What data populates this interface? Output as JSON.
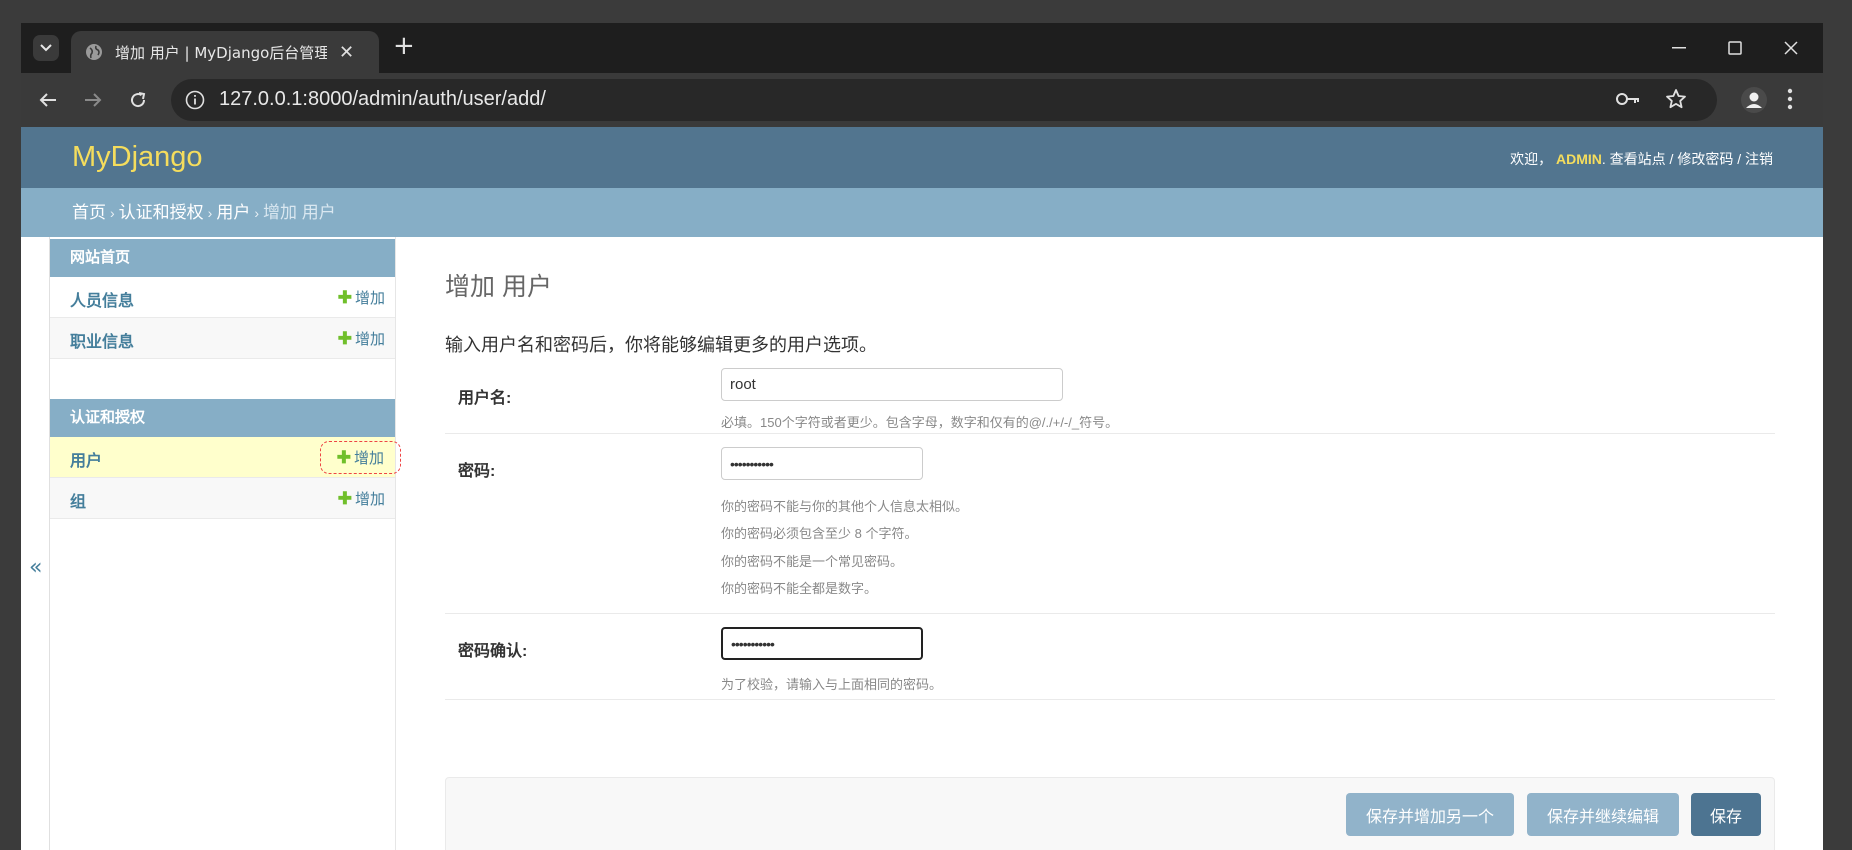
{
  "browser": {
    "tab_title": "增加 用户 | MyDjango后台管理",
    "url": "127.0.0.1:8000/admin/auth/user/add/"
  },
  "header": {
    "brand": "MyDjango",
    "welcome": "欢迎，",
    "username": "ADMIN",
    "view_site": "查看站点",
    "change_password": "修改密码",
    "logout": "注销",
    "sep": "/"
  },
  "breadcrumbs": {
    "home": "首页",
    "app": "认证和授权",
    "model": "用户",
    "current": "增加 用户",
    "sep": "›"
  },
  "sidebar": {
    "collapse": "«",
    "add_label": "增加",
    "modules": [
      {
        "caption": "网站首页",
        "items": [
          {
            "label": "人员信息"
          },
          {
            "label": "职业信息"
          }
        ]
      },
      {
        "caption": "认证和授权",
        "items": [
          {
            "label": "用户"
          },
          {
            "label": "组"
          }
        ]
      }
    ]
  },
  "content": {
    "title": "增加 用户",
    "intro": "输入用户名和密码后，你将能够编辑更多的用户选项。",
    "fields": {
      "username": {
        "label": "用户名:",
        "value": "root",
        "help": "必填。150个字符或者更少。包含字母，数字和仅有的@/./+/-/_符号。"
      },
      "password": {
        "label": "密码:",
        "value": "•••••••••••",
        "help": [
          "你的密码不能与你的其他个人信息太相似。",
          "你的密码必须包含至少 8 个字符。",
          "你的密码不能是一个常见密码。",
          "你的密码不能全都是数字。"
        ]
      },
      "password_confirm": {
        "label": "密码确认:",
        "value": "•••••••••••",
        "help": "为了校验，请输入与上面相同的密码。"
      }
    },
    "buttons": {
      "save_add_another": "保存并增加另一个",
      "save_continue": "保存并继续编辑",
      "save": "保存"
    }
  }
}
